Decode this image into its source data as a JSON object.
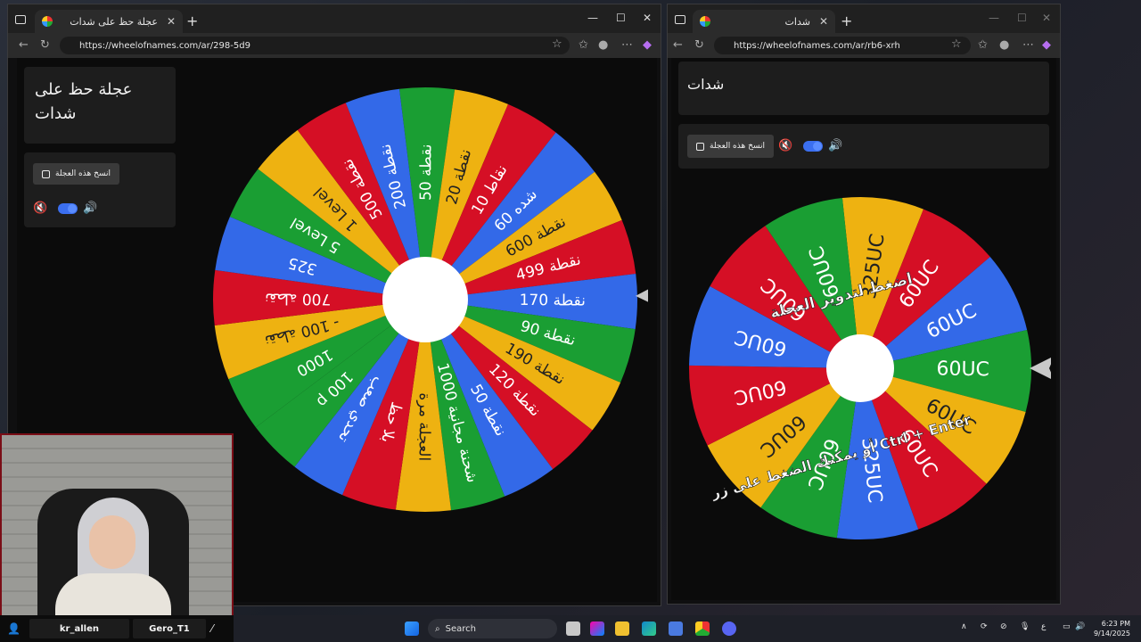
{
  "left_window": {
    "tab_title": "عجلة حظ على شدات",
    "url": "https://wheelofnames.com/ar/298-5d9",
    "card_title": "عجلة حظ على شدات",
    "duplicate_label": "انسخ هذه العجلة",
    "wheel": {
      "segments": [
        {
          "label": "نقطة 50",
          "color": "#1a9e33",
          "text_color": "#ffffff"
        },
        {
          "label": "نقطة 20",
          "color": "#eeb211",
          "text_color": "#222222"
        },
        {
          "label": "نقاط 10",
          "color": "#d50f25",
          "text_color": "#ffffff"
        },
        {
          "label": "شده 60",
          "color": "#3369e8",
          "text_color": "#ffffff"
        },
        {
          "label": "نقطة 600",
          "color": "#eeb211",
          "text_color": "#222222"
        },
        {
          "label": "نقطة 499",
          "color": "#d50f25",
          "text_color": "#ffffff"
        },
        {
          "label": "نقطة 170",
          "color": "#3369e8",
          "text_color": "#ffffff"
        },
        {
          "label": "نقطة 90",
          "color": "#1a9e33",
          "text_color": "#ffffff"
        },
        {
          "label": "نقطة 190",
          "color": "#eeb211",
          "text_color": "#222222"
        },
        {
          "label": "نقطة 120",
          "color": "#d50f25",
          "text_color": "#ffffff"
        },
        {
          "label": "نقطة 50",
          "color": "#3369e8",
          "text_color": "#ffffff"
        },
        {
          "label": "1000 شحنة مجانية",
          "color": "#1a9e33",
          "text_color": "#ffffff"
        },
        {
          "label": "العجلة مرة",
          "color": "#eeb211",
          "text_color": "#222222"
        },
        {
          "label": "بلا حظ",
          "color": "#d50f25",
          "text_color": "#ffffff"
        },
        {
          "label": "تحدي صعب",
          "color": "#3369e8",
          "text_color": "#ffffff"
        },
        {
          "label": "100 p",
          "color": "#1a9e33",
          "text_color": "#ffffff"
        },
        {
          "label": "1000",
          "color": "#1a9e33",
          "text_color": "#ffffff"
        },
        {
          "label": "- 100 نقطة",
          "color": "#eeb211",
          "text_color": "#222222"
        },
        {
          "label": "700 نقطة",
          "color": "#d50f25",
          "text_color": "#ffffff"
        },
        {
          "label": "325",
          "color": "#3369e8",
          "text_color": "#ffffff"
        },
        {
          "label": "5 Level",
          "color": "#1a9e33",
          "text_color": "#ffffff"
        },
        {
          "label": "1 Level",
          "color": "#eeb211",
          "text_color": "#222222"
        },
        {
          "label": "500 نقطة",
          "color": "#d50f25",
          "text_color": "#ffffff"
        },
        {
          "label": "نقطة 200",
          "color": "#3369e8",
          "text_color": "#ffffff"
        }
      ]
    }
  },
  "right_window": {
    "tab_title": "شدات",
    "url": "https://wheelofnames.com/ar/rb6-xrh",
    "card_title": "شدات",
    "duplicate_label": "انسخ هذه العجلة",
    "spin_hint_top": "اضغط لتدوير العجلة",
    "spin_hint_bottom": "أو يمكنك الضغط على زر Ctrl + Enter",
    "wheel": {
      "segments": [
        {
          "label": "325UC",
          "color": "#eeb211",
          "text_color": "#222222"
        },
        {
          "label": "60UC",
          "color": "#d50f25",
          "text_color": "#ffffff"
        },
        {
          "label": "60UC",
          "color": "#3369e8",
          "text_color": "#ffffff"
        },
        {
          "label": "60UC",
          "color": "#1a9e33",
          "text_color": "#ffffff"
        },
        {
          "label": "60UC",
          "color": "#eeb211",
          "text_color": "#222222"
        },
        {
          "label": "60UC",
          "color": "#d50f25",
          "text_color": "#ffffff"
        },
        {
          "label": "325UC",
          "color": "#3369e8",
          "text_color": "#ffffff"
        },
        {
          "label": "60UC",
          "color": "#1a9e33",
          "text_color": "#ffffff"
        },
        {
          "label": "60UC",
          "color": "#eeb211",
          "text_color": "#222222"
        },
        {
          "label": "60UC",
          "color": "#d50f25",
          "text_color": "#ffffff"
        },
        {
          "label": "60UC",
          "color": "#3369e8",
          "text_color": "#ffffff"
        },
        {
          "label": "60UC",
          "color": "#d50f25",
          "text_color": "#ffffff"
        },
        {
          "label": "60UC",
          "color": "#1a9e33",
          "text_color": "#ffffff"
        }
      ]
    }
  },
  "webcam": {
    "names": [
      "kr_allen",
      "Gero_T1"
    ]
  },
  "taskbar": {
    "search_label": "Search",
    "time": "6:23 PM",
    "date": "9/14/2025",
    "lang": "ع"
  }
}
